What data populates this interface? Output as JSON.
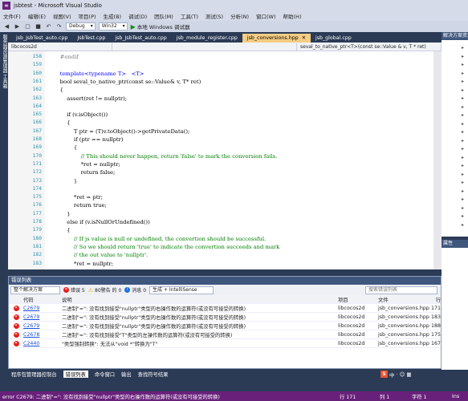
{
  "window": {
    "title": "jsbtest - Microsoft Visual Studio"
  },
  "menu": [
    "文件(F)",
    "编辑(E)",
    "视图(V)",
    "项目(P)",
    "生成(B)",
    "调试(D)",
    "团队(M)",
    "工具(T)",
    "测试(S)",
    "分析(N)",
    "窗口(W)",
    "帮助(H)"
  ],
  "toolbar": {
    "config": "Debug",
    "platform": "Win32",
    "run_label": "本地 Windows 调试器"
  },
  "left_side": {
    "label": "服务器资源管理器 工具箱"
  },
  "tabs": [
    {
      "label": "jsb_JsbTest_auto.cpp",
      "active": false
    },
    {
      "label": "JsbTest.cpp",
      "active": false
    },
    {
      "label": "jsb_JsbTest_auto.cpp",
      "active": false
    },
    {
      "label": "jsb_module_register.cpp",
      "active": false
    },
    {
      "label": "jsb_conversions.hpp",
      "active": true
    },
    {
      "label": "jsb_global.cpp",
      "active": false
    }
  ],
  "navbar": {
    "project": "libcocos2d",
    "scope": "",
    "member": "seval_to_native_ptr<T>(const se::Value & v, T * ret)"
  },
  "code_lines": [
    {
      "n": "158",
      "t": "    #endif",
      "c": "pp"
    },
    {
      "n": "159",
      "t": "",
      "c": ""
    },
    {
      "n": "160",
      "t": "    template<typename T>   <T>",
      "c": "kw"
    },
    {
      "n": "161",
      "t": "    bool seval_to_native_ptr(const se::Value& v, T* ret)",
      "c": ""
    },
    {
      "n": "162",
      "t": "    {",
      "c": ""
    },
    {
      "n": "163",
      "t": "        assert(ret != nullptr);",
      "c": ""
    },
    {
      "n": "164",
      "t": "",
      "c": ""
    },
    {
      "n": "165",
      "t": "        if (v.isObject())",
      "c": ""
    },
    {
      "n": "166",
      "t": "        {",
      "c": ""
    },
    {
      "n": "167",
      "t": "            T ptr = (T)v.toObject()->getPrivateData();",
      "c": ""
    },
    {
      "n": "168",
      "t": "            if (ptr == nullptr)",
      "c": ""
    },
    {
      "n": "169",
      "t": "            {",
      "c": ""
    },
    {
      "n": "170",
      "t": "                // This should never happen, return 'false' to mark the conversion fails.",
      "c": "cm"
    },
    {
      "n": "171",
      "t": "                *ret = nullptr;",
      "c": ""
    },
    {
      "n": "172",
      "t": "                return false;",
      "c": ""
    },
    {
      "n": "173",
      "t": "            }",
      "c": ""
    },
    {
      "n": "174",
      "t": "",
      "c": ""
    },
    {
      "n": "175",
      "t": "            *ret = ptr;",
      "c": ""
    },
    {
      "n": "176",
      "t": "            return true;",
      "c": ""
    },
    {
      "n": "177",
      "t": "        }",
      "c": ""
    },
    {
      "n": "178",
      "t": "        else if (v.isNullOrUndefined())",
      "c": ""
    },
    {
      "n": "179",
      "t": "        {",
      "c": ""
    },
    {
      "n": "180",
      "t": "            // If js value is null or undefined, the convertion should be successful.",
      "c": "cm"
    },
    {
      "n": "181",
      "t": "            // So we should return 'true' to indicate the convertion succeeds and mark",
      "c": "cm"
    },
    {
      "n": "182",
      "t": "            // the out value to 'nullptr'.",
      "c": "cm"
    },
    {
      "n": "183",
      "t": "            *ret = nullptr;",
      "c": ""
    }
  ],
  "right_panel": {
    "header": "解决方案资源管理器",
    "header2": "属性"
  },
  "error_list": {
    "title": "错误列表",
    "scope": "整个解决方案",
    "errors_label": "错误 5",
    "warnings_label": "80警告 的 0",
    "messages_label": "消息 0",
    "build_filter": "生成 + IntelliSense",
    "search_placeholder": "搜索错误列表",
    "columns": {
      "code": "代码",
      "desc": "说明",
      "project": "项目",
      "file": "文件",
      "line": "行"
    },
    "rows": [
      {
        "code": "C2679",
        "desc": "二进制\"=\": 没有找到接受\"nullptr\"类型的右操作数的运算符(或没有可接受的转换)",
        "project": "libcocos2d",
        "file": "jsb_conversions.hpp",
        "line": "171"
      },
      {
        "code": "C2679",
        "desc": "二进制\"=\": 没有找到接受\"nullptr\"类型的右操作数的运算符(或没有可接受的转换)",
        "project": "libcocos2d",
        "file": "jsb_conversions.hpp",
        "line": "183"
      },
      {
        "code": "C2679",
        "desc": "二进制\"=\": 没有找到接受\"nullptr\"类型的右操作数的运算符(或没有可接受的转换)",
        "project": "libcocos2d",
        "file": "jsb_conversions.hpp",
        "line": "188"
      },
      {
        "code": "C2678",
        "desc": "二进制\"=\": 没有找到接受\"T\"类型的左操作数的运算符(或没有可接受的转换)",
        "project": "libcocos2d",
        "file": "jsb_conversions.hpp",
        "line": "175"
      },
      {
        "code": "C2440",
        "desc": "\"类型强制转换\": 无法从\"void *\"转换为\"T\"",
        "project": "libcocos2d",
        "file": "jsb_conversions.hpp",
        "line": "167"
      }
    ]
  },
  "bottom_tabs": [
    {
      "label": "程序包管理器控制台",
      "on": false
    },
    {
      "label": "错误列表",
      "on": true
    },
    {
      "label": "命令窗口",
      "on": false
    },
    {
      "label": "输出",
      "on": false
    },
    {
      "label": "查找符号结果",
      "on": false
    }
  ],
  "status": {
    "message": "error C2679: 二进制\"=\": 没有找到接受\"nullptr\"类型的右操作数的运算符(或没有可接受的转换)",
    "line": "行 171",
    "col": "列 1",
    "char": "字符 1",
    "mode": "Ins"
  },
  "ime": {
    "label": "S"
  },
  "colors": {
    "accent": "#68217a",
    "active_tab": "#f5cc84",
    "chrome": "#2b3a55"
  }
}
